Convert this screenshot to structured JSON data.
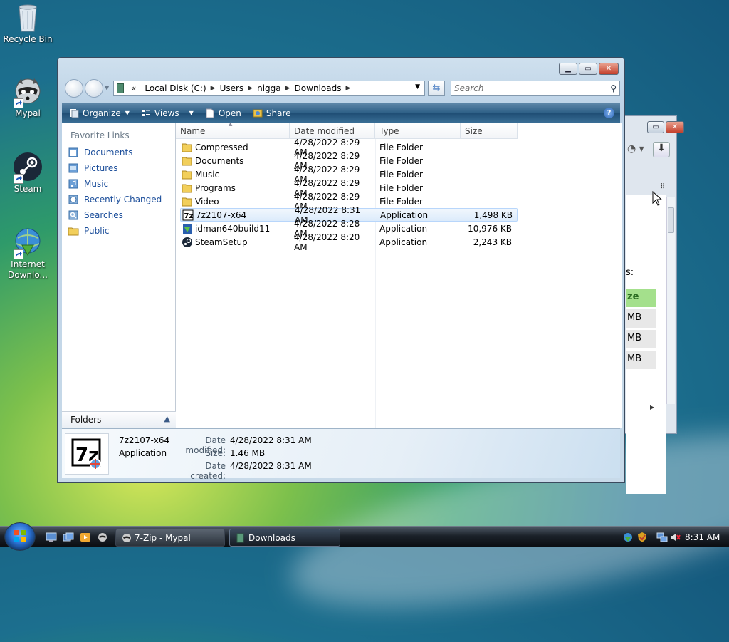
{
  "desktop": {
    "icons": [
      {
        "label": "Recycle Bin"
      },
      {
        "label": "Mypal"
      },
      {
        "label": "Steam"
      },
      {
        "label": "Internet Downlo..."
      }
    ]
  },
  "background_window": {
    "fragments": [
      "s:",
      "ze",
      "MB",
      "MB",
      "MB"
    ]
  },
  "explorer": {
    "address": {
      "overflow": "«",
      "crumbs": [
        "Local Disk (C:)",
        "Users",
        "nigga",
        "Downloads"
      ]
    },
    "search_placeholder": "Search",
    "toolbar": {
      "organize": "Organize",
      "views": "Views",
      "open": "Open",
      "share": "Share",
      "help": "?"
    },
    "nav": {
      "header": "Favorite Links",
      "links": [
        "Documents",
        "Pictures",
        "Music",
        "Recently Changed",
        "Searches",
        "Public"
      ],
      "folders_label": "Folders"
    },
    "columns": [
      "Name",
      "Date modified",
      "Type",
      "Size"
    ],
    "rows": [
      {
        "name": "Compressed",
        "date": "4/28/2022 8:29 AM",
        "type": "File Folder",
        "size": "",
        "icon": "folder-icon"
      },
      {
        "name": "Documents",
        "date": "4/28/2022 8:29 AM",
        "type": "File Folder",
        "size": "",
        "icon": "folder-icon"
      },
      {
        "name": "Music",
        "date": "4/28/2022 8:29 AM",
        "type": "File Folder",
        "size": "",
        "icon": "folder-icon"
      },
      {
        "name": "Programs",
        "date": "4/28/2022 8:29 AM",
        "type": "File Folder",
        "size": "",
        "icon": "folder-icon"
      },
      {
        "name": "Video",
        "date": "4/28/2022 8:29 AM",
        "type": "File Folder",
        "size": "",
        "icon": "folder-icon"
      },
      {
        "name": "7z2107-x64",
        "date": "4/28/2022 8:31 AM",
        "type": "Application",
        "size": "1,498 KB",
        "icon": "7zip-icon"
      },
      {
        "name": "idman640build11",
        "date": "4/28/2022 8:28 AM",
        "type": "Application",
        "size": "10,976 KB",
        "icon": "idm-icon"
      },
      {
        "name": "SteamSetup",
        "date": "4/28/2022 8:20 AM",
        "type": "Application",
        "size": "2,243 KB",
        "icon": "steam-icon"
      }
    ],
    "selected_row": "7z2107-x64",
    "details": {
      "name": "7z2107-x64",
      "type": "Application",
      "modified_label": "Date modified:",
      "modified_value": "4/28/2022 8:31 AM",
      "size_label": "Size:",
      "size_value": "1.46 MB",
      "created_label": "Date created:",
      "created_value": "4/28/2022 8:31 AM"
    }
  },
  "taskbar": {
    "buttons": [
      {
        "label": "7-Zip - Mypal"
      },
      {
        "label": "Downloads"
      }
    ],
    "clock": "8:31 AM"
  }
}
